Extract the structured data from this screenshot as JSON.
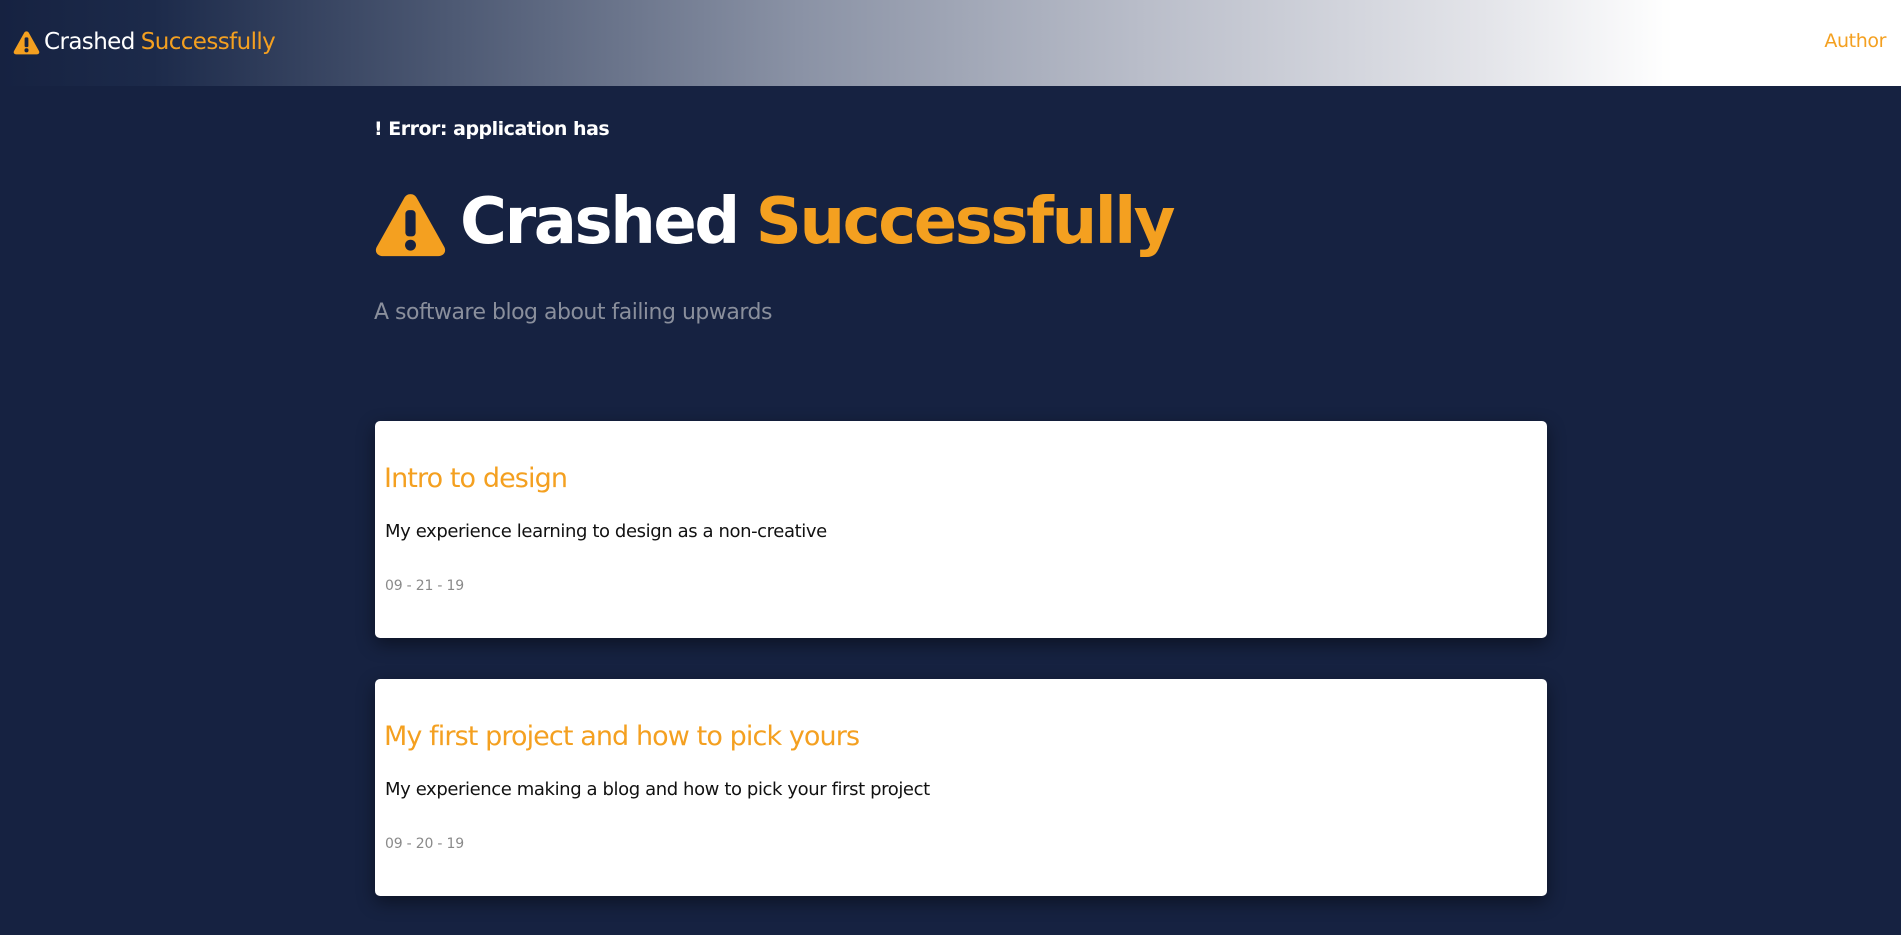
{
  "colors": {
    "background": "#162241",
    "accent": "#f4a020",
    "title_text": "#ffffff",
    "tagline_text": "#8a8f9c",
    "card_background": "#ffffff",
    "date_text": "#8a8a8a"
  },
  "navbar": {
    "brand_icon": "warning-triangle-icon",
    "brand_word1": "Crashed",
    "brand_word2": "Successfully",
    "author_link": "Author"
  },
  "hero": {
    "error_label": "! Error: application has",
    "title_icon": "warning-triangle-icon",
    "title_word1": "Crashed",
    "title_word2": "Successfully",
    "tagline": "A software blog about failing upwards"
  },
  "posts": [
    {
      "title": "Intro to design",
      "excerpt": "My experience learning to design as a non-creative",
      "date": "09 - 21 - 19"
    },
    {
      "title": "My first project and how to pick yours",
      "excerpt": "My experience making a blog and how to pick your first project",
      "date": "09 - 20 - 19"
    }
  ]
}
